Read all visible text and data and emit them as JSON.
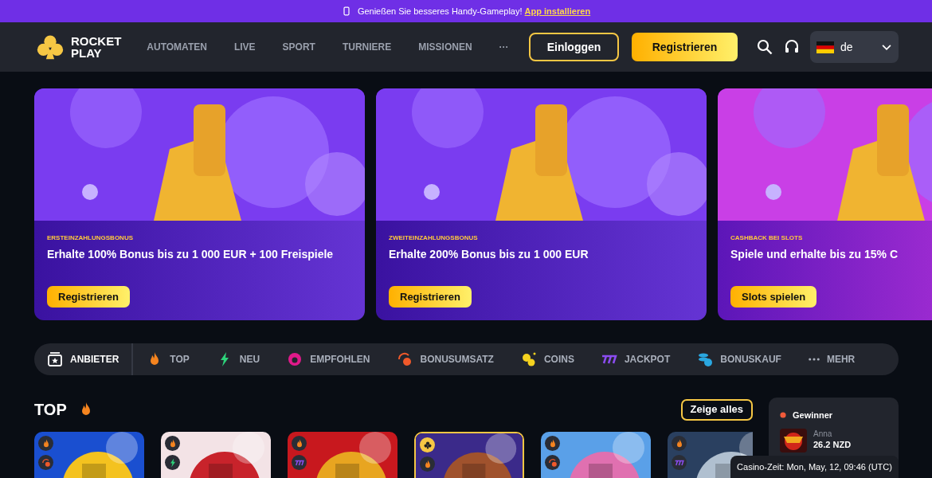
{
  "banner": {
    "text": "Genießen Sie besseres Handy-Gameplay!",
    "link": "App installieren"
  },
  "header": {
    "logo": [
      "ROCKET",
      "PLAY"
    ],
    "nav": [
      "AUTOMATEN",
      "LIVE",
      "SPORT",
      "TURNIERE",
      "MISSIONEN",
      "···"
    ],
    "login": "Einloggen",
    "register": "Registrieren",
    "language": "de"
  },
  "promos": [
    {
      "tag": "ERSTEINZAHLUNGSBONUS",
      "title": "Erhalte 100% Bonus bis zu 1 000 EUR + 100 Freispiele",
      "button": "Registrieren",
      "kind": "first"
    },
    {
      "tag": "ZWEITEINZAHLUNGSBONUS",
      "title": "Erhalte 200% Bonus bis zu 1 000 EUR",
      "button": "Registrieren",
      "kind": "second"
    },
    {
      "tag": "CASHBACK BEI SLOTS",
      "title": "Spiele und erhalte bis zu 15% C",
      "button": "Slots spielen",
      "kind": "cashback"
    }
  ],
  "categories": [
    {
      "label": "ANBIETER",
      "kind": "provider",
      "selected": true
    },
    {
      "label": "TOP",
      "kind": "fire",
      "selected": false
    },
    {
      "label": "NEU",
      "kind": "bolt",
      "selected": false
    },
    {
      "label": "EMPFOHLEN",
      "kind": "recommended",
      "selected": false
    },
    {
      "label": "BONUSUMSATZ",
      "kind": "bonus",
      "selected": false
    },
    {
      "label": "COINS",
      "kind": "coins",
      "selected": false
    },
    {
      "label": "JACKPOT",
      "kind": "jackpot",
      "selected": false
    },
    {
      "label": "BONUSKAUF",
      "kind": "buy",
      "selected": false
    },
    {
      "label": "MEHR",
      "kind": "more",
      "selected": false
    }
  ],
  "top": {
    "title": "TOP",
    "show_all": "Zeige alles",
    "games": [
      {
        "badges": [
          {
            "kind": "fire"
          },
          {
            "kind": "bonus"
          }
        ],
        "featured": false
      },
      {
        "badges": [
          {
            "kind": "fire"
          },
          {
            "kind": "bolt"
          }
        ],
        "featured": false
      },
      {
        "badges": [
          {
            "kind": "fire"
          },
          {
            "kind": "jackpot"
          }
        ],
        "featured": false
      },
      {
        "badges": [
          {
            "kind": "club"
          },
          {
            "kind": "fire"
          }
        ],
        "featured": true
      },
      {
        "badges": [
          {
            "kind": "fire"
          },
          {
            "kind": "bonus"
          }
        ],
        "featured": false
      },
      {
        "badges": [
          {
            "kind": "fire"
          },
          {
            "kind": "jackpot"
          }
        ],
        "featured": false
      }
    ]
  },
  "winner": {
    "label": "Gewinner",
    "name": "Anna",
    "amount": "26.2 NZD"
  },
  "casino_time": "Casino-Zeit: Mon, May, 12, 09:46 (UTC)"
}
